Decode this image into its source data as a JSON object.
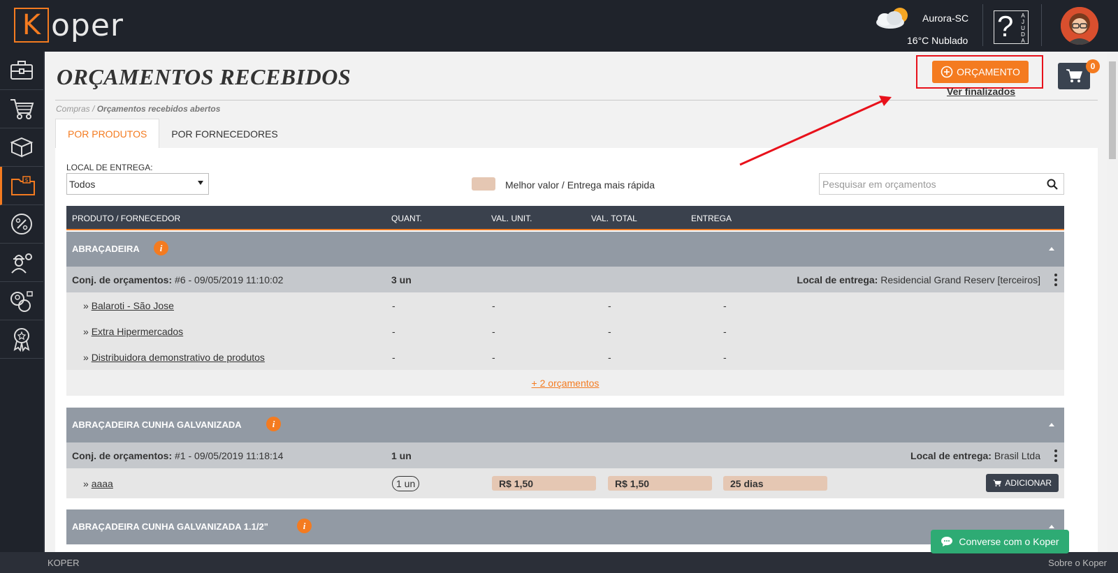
{
  "app": {
    "logo_letter": "K",
    "logo_rest": "oper"
  },
  "weather": {
    "city": "Aurora-SC",
    "condition": "16°C Nublado"
  },
  "help": {
    "symbol": "?",
    "side_text": "AJUDA"
  },
  "page": {
    "title": "ORÇAMENTOS RECEBIDOS",
    "breadcrumb_root": "Compras /",
    "breadcrumb_current": "Orçamentos recebidos abertos",
    "new_button": "ORÇAMENTO",
    "ver_finalizados": "Ver finalizados",
    "cart_count": "0"
  },
  "tabs": [
    {
      "label": "POR PRODUTOS",
      "active": true
    },
    {
      "label": "POR FORNECEDORES",
      "active": false
    }
  ],
  "filters": {
    "local_label": "LOCAL DE ENTREGA:",
    "local_value": "Todos",
    "legend": "Melhor valor / Entrega mais rápida",
    "search_placeholder": "Pesquisar em orçamentos"
  },
  "table": {
    "headers": [
      "PRODUTO / FORNECEDOR",
      "QUANT.",
      "VAL. UNIT.",
      "VAL. TOTAL",
      "ENTREGA"
    ]
  },
  "groups": [
    {
      "name": "ABRAÇADEIRA",
      "conj_label": "Conj. de orçamentos:",
      "conj_value": "#6 - 09/05/2019 11:10:02",
      "qty": "3 un",
      "local_label": "Local de entrega:",
      "local_value": "Residencial Grand Reserv [terceiros]",
      "suppliers": [
        {
          "name": "Balaroti - São Jose",
          "qty": "-",
          "unit": "-",
          "total": "-",
          "delivery": "-"
        },
        {
          "name": "Extra Hipermercados",
          "qty": "-",
          "unit": "-",
          "total": "-",
          "delivery": "-"
        },
        {
          "name": "Distribuidora demonstrativo de produtos",
          "qty": "-",
          "unit": "-",
          "total": "-",
          "delivery": "-"
        }
      ],
      "more": "+ 2 orçamentos"
    },
    {
      "name": "ABRAÇADEIRA CUNHA GALVANIZADA",
      "conj_label": "Conj. de orçamentos:",
      "conj_value": "#1 - 09/05/2019 11:18:14",
      "qty": "1 un",
      "local_label": "Local de entrega:",
      "local_value": "Brasil Ltda",
      "suppliers": [
        {
          "name": "aaaa",
          "qty": "1 un",
          "unit": "R$ 1,50",
          "total": "R$ 1,50",
          "delivery": "25 dias",
          "action": "ADICIONAR"
        }
      ]
    },
    {
      "name": "ABRAÇADEIRA CUNHA GALVANIZADA 1.1/2\""
    }
  ],
  "chat": {
    "label": "Converse com o Koper"
  },
  "footer": {
    "left": "KOPER",
    "right": "Sobre o Koper"
  },
  "colors": {
    "accent": "#f47b20",
    "topbar": "#1f232b",
    "highlight_cell": "#e5c7b3",
    "annotation_red": "#e8111b",
    "chat": "#2eab74"
  }
}
